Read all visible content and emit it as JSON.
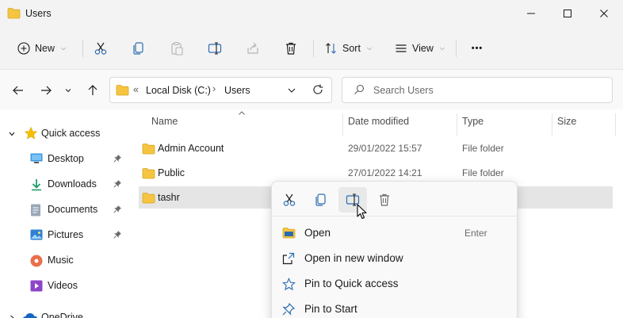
{
  "window": {
    "title": "Users"
  },
  "toolbar": {
    "new_label": "New",
    "sort_label": "Sort",
    "view_label": "View",
    "more_label": "•••"
  },
  "address": {
    "overflow": "«",
    "crumbs": [
      "Local Disk (C:)",
      "Users"
    ],
    "separator": "›"
  },
  "search": {
    "placeholder": "Search Users"
  },
  "sidebar": {
    "items": [
      {
        "label": "Quick access",
        "icon": "star-icon"
      },
      {
        "label": "Desktop",
        "icon": "desktop-icon"
      },
      {
        "label": "Downloads",
        "icon": "download-icon"
      },
      {
        "label": "Documents",
        "icon": "documents-icon"
      },
      {
        "label": "Pictures",
        "icon": "pictures-icon"
      },
      {
        "label": "Music",
        "icon": "music-icon"
      },
      {
        "label": "Videos",
        "icon": "videos-icon"
      },
      {
        "label": "OneDrive",
        "icon": "cloud-icon"
      }
    ]
  },
  "columns": {
    "name": "Name",
    "date": "Date modified",
    "type": "File folder",
    "type_header": "Type",
    "size": "Size"
  },
  "files": [
    {
      "name": "Admin Account",
      "date": "29/01/2022 15:57",
      "type": "File folder"
    },
    {
      "name": "Public",
      "date": "27/01/2022 14:21",
      "type": "File folder"
    },
    {
      "name": "tashr",
      "date": "",
      "type": ""
    }
  ],
  "context_menu": {
    "items": [
      {
        "label": "Open",
        "shortcut": "Enter"
      },
      {
        "label": "Open in new window",
        "shortcut": ""
      },
      {
        "label": "Pin to Quick access",
        "shortcut": ""
      },
      {
        "label": "Pin to Start",
        "shortcut": ""
      }
    ]
  },
  "colors": {
    "folder": "#f5c542",
    "accent": "#0067c0",
    "selection": "#e5e5e5"
  }
}
